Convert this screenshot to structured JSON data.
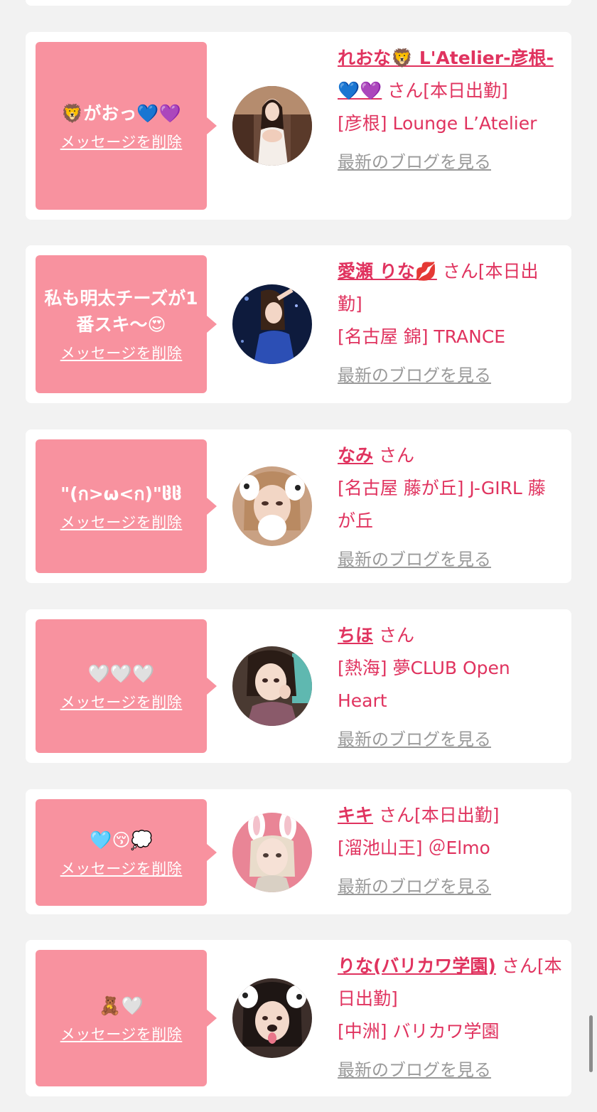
{
  "delete_label": "メッセージを削除",
  "blog_label": "最新のブログを見る",
  "colors": {
    "background": "#f2f2f2",
    "card": "#ffffff",
    "bubble": "#f8929f",
    "accent": "#e0335f",
    "link_gray": "#9a9a9a"
  },
  "cards": [
    {
      "message": "🦁がおっ💙💜",
      "name": "れおな🦁 L'Atelier-彦根-💙💜",
      "san": "さん[本日出勤]",
      "shop": "[彦根] Lounge L’Atelier"
    },
    {
      "message": "私も明太チーズが1番スキ〜😍",
      "name": "愛瀬 りな💋",
      "san": "さん[本日出勤]",
      "shop": "[名古屋 錦] TRANCE"
    },
    {
      "message": "\"(ก>ω<ก)\"ჱ̒ჱ̒",
      "name": "なみ",
      "san": "さん",
      "shop": "[名古屋 藤が丘] J-GIRL 藤が丘"
    },
    {
      "message": "🤍🤍🤍",
      "name": "ちほ",
      "san": "さん",
      "shop": "[熱海] 夢CLUB Open Heart"
    },
    {
      "message": "🩵😚💭",
      "name": "キキ",
      "san": "さん[本日出勤]",
      "shop": "[溜池山王] ＠Elmo"
    },
    {
      "message": "🧸🤍",
      "name": "りな(バリカワ学園)",
      "san": "さん[本日出勤]",
      "shop": "[中洲] バリカワ学園"
    }
  ]
}
